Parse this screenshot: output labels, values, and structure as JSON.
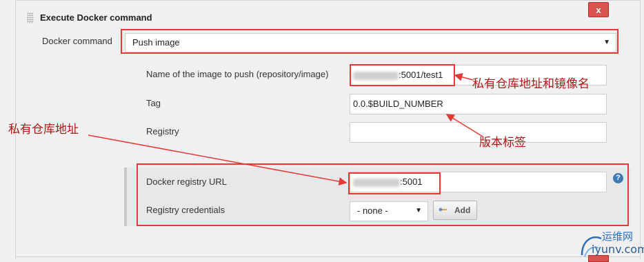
{
  "section": {
    "title": "Execute Docker command",
    "close_label": "x"
  },
  "form": {
    "docker_command_label": "Docker command",
    "docker_command_value": "Push image",
    "image_name_label": "Name of the image to push (repository/image)",
    "image_name_value": ":5001/test1",
    "tag_label": "Tag",
    "tag_value": "0.0.$BUILD_NUMBER",
    "registry_label": "Registry",
    "registry_value": "",
    "docker_registry_url_label": "Docker registry URL",
    "docker_registry_url_value": ":5001",
    "registry_credentials_label": "Registry credentials",
    "registry_credentials_value": "- none -",
    "add_button_label": "Add",
    "help_label": "?"
  },
  "annotations": {
    "image_name_note": "私有仓库地址和镜像名",
    "tag_note": "版本标签",
    "registry_note": "私有仓库地址"
  },
  "watermark": {
    "cn": "运维网",
    "en": "iyunv.com"
  },
  "colors": {
    "annotation_red": "#e53935",
    "close_red": "#d9534f",
    "help_blue": "#3f79b5"
  }
}
